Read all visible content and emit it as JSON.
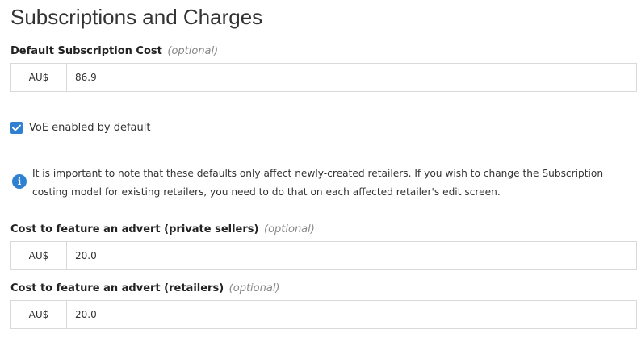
{
  "section": {
    "title": "Subscriptions and Charges"
  },
  "default_subscription": {
    "label": "Default Subscription Cost",
    "optional": "(optional)",
    "prefix": "AU$",
    "value": "86.9"
  },
  "voe": {
    "label": "VoE enabled by default",
    "checked": true
  },
  "info": {
    "icon": "info-icon",
    "text": "It is important to note that these defaults only affect newly-created retailers. If you wish to change the Subscription costing model for existing retailers, you need to do that on each affected retailer's edit screen."
  },
  "advert_private": {
    "label": "Cost to feature an advert (private sellers)",
    "optional": "(optional)",
    "prefix": "AU$",
    "value": "20.0"
  },
  "advert_retailers": {
    "label": "Cost to feature an advert (retailers)",
    "optional": "(optional)",
    "prefix": "AU$",
    "value": "20.0"
  },
  "colors": {
    "accent": "#2f80d1",
    "border": "#d9d9d9",
    "muted": "#888888"
  }
}
